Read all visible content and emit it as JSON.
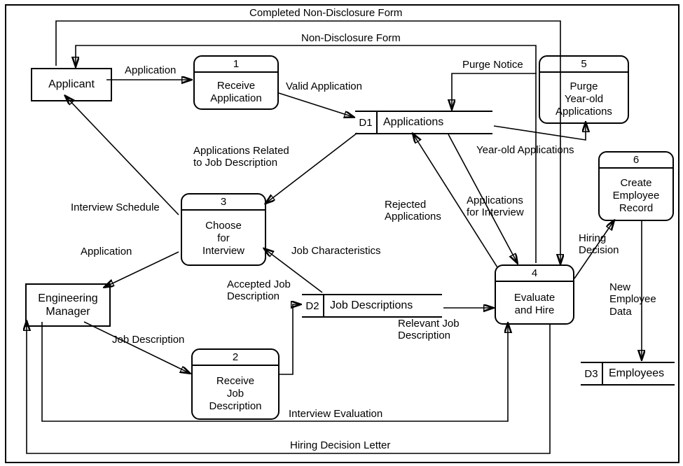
{
  "entities": {
    "applicant": "Applicant",
    "eng_mgr": "Engineering\nManager"
  },
  "processes": {
    "p1": {
      "num": "1",
      "name": "Receive\nApplication"
    },
    "p2": {
      "num": "2",
      "name": "Receive\nJob\nDescription"
    },
    "p3": {
      "num": "3",
      "name": "Choose\nfor\nInterview"
    },
    "p4": {
      "num": "4",
      "name": "Evaluate\nand Hire"
    },
    "p5": {
      "num": "5",
      "name": "Purge\nYear-old\nApplications"
    },
    "p6": {
      "num": "6",
      "name": "Create\nEmployee\nRecord"
    },
    "d1": {
      "key": "D1",
      "name": "Applications"
    },
    "d2": {
      "key": "D2",
      "name": "Job Descriptions"
    },
    "d3": {
      "key": "D3",
      "name": "Employees"
    }
  },
  "flows": {
    "completed_ndf": "Completed Non-Disclosure Form",
    "ndf": "Non-Disclosure Form",
    "application": "Application",
    "valid_app": "Valid Application",
    "purge_notice": "Purge Notice",
    "year_old": "Year-old Applications",
    "apps_related": "Applications Related\nto Job Description",
    "interview_sched": "Interview Schedule",
    "application2": "Application",
    "job_chars": "Job Characteristics",
    "rejected": "Rejected\nApplications",
    "apps_for_int": "Applications\nfor Interview",
    "hiring_dec": "Hiring\nDecision",
    "new_emp": "New\nEmployee\nData",
    "accepted_jd": "Accepted Job\nDescription",
    "job_desc": "Job Description",
    "relevant_jd": "Relevant Job\nDescription",
    "interview_eval": "Interview Evaluation",
    "hiring_letter": "Hiring Decision Letter"
  }
}
